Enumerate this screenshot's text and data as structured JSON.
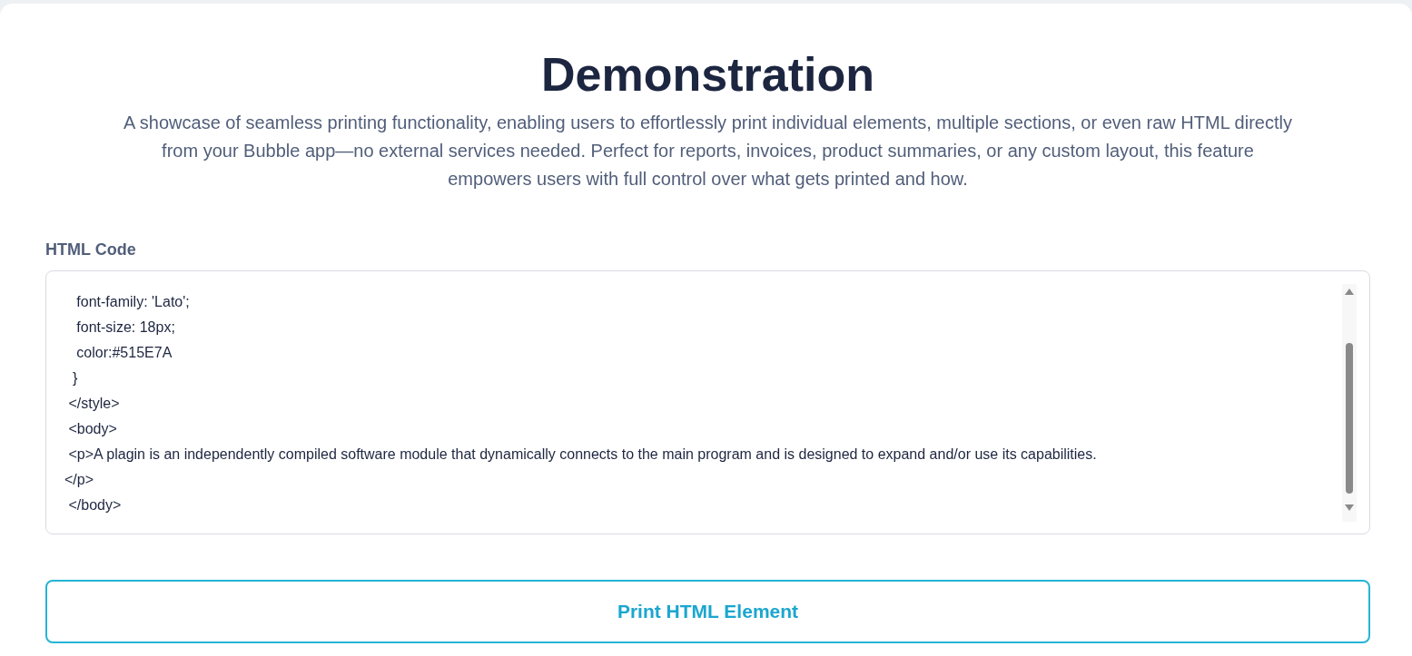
{
  "title": "Demonstration",
  "description": "A showcase of seamless printing functionality, enabling users to effortlessly print individual elements, multiple sections, or even raw HTML directly from your Bubble app—no external services needed. Perfect for reports, invoices, product summaries, or any custom layout, this feature empowers users with full control over what gets printed and how.",
  "html_code": {
    "label": "HTML Code",
    "value": "   font-family: 'Lato';\n   font-size: 18px;\n   color:#515E7A\n  }\n </style>\n <body>\n <p>A plagin is an independently compiled software module that dynamically connects to the main program and is designed to expand and/or use its capabilities.\n</p>\n </body>"
  },
  "print_button": {
    "label": "Print HTML Element"
  }
}
